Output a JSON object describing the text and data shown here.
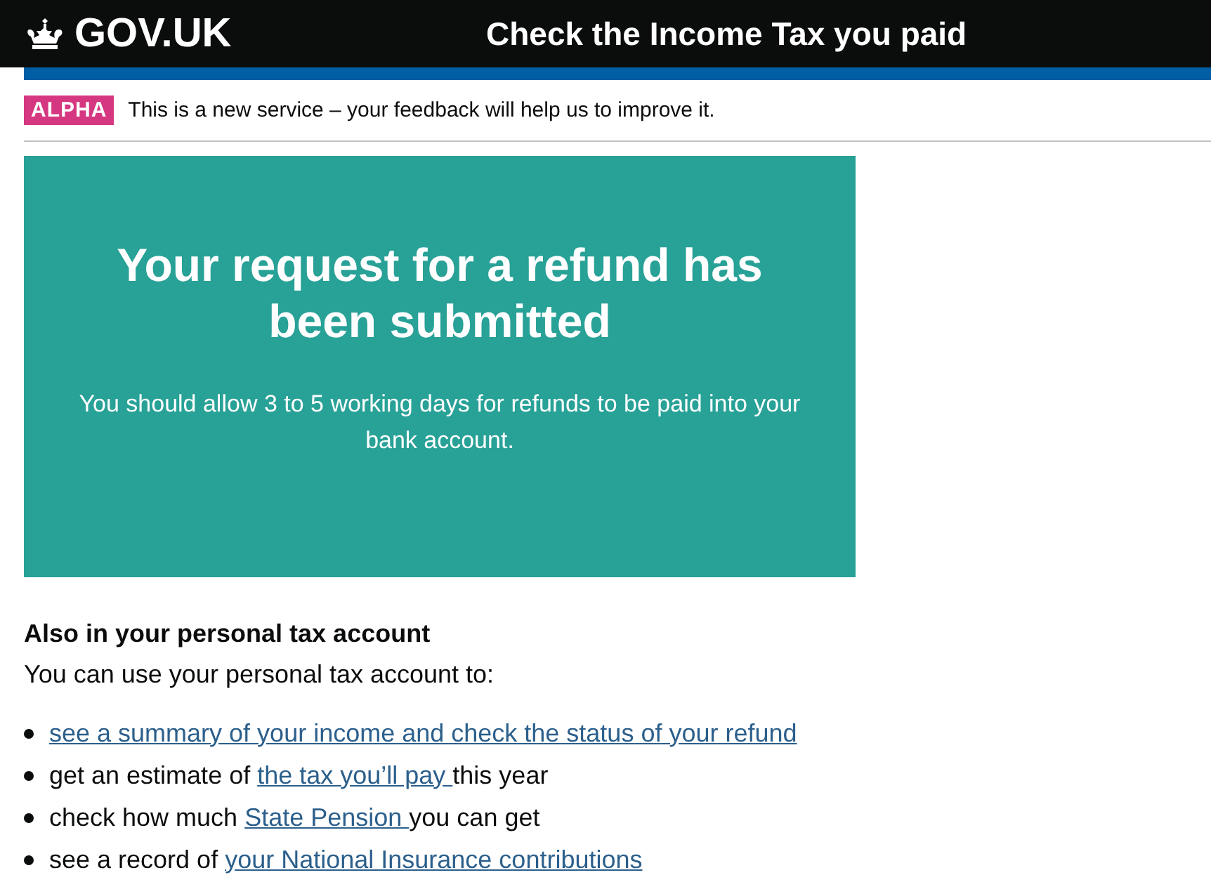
{
  "header": {
    "logo_text": "GOV.UK",
    "service_name": "Check the Income Tax you paid"
  },
  "phase_banner": {
    "tag": "ALPHA",
    "text": "This is a new service – your feedback will help us to improve it."
  },
  "confirmation_panel": {
    "title": "Your request for a refund has been submitted",
    "body": "You should allow 3 to 5 working days for refunds to be paid into your bank account."
  },
  "section": {
    "heading": "Also in your personal tax account",
    "intro": "You can use your personal tax account to:",
    "items": [
      {
        "link": "see a summary of your income and check the status of your refund"
      },
      {
        "before": "get an estimate of ",
        "link": "the tax you’ll pay ",
        "after": "this year"
      },
      {
        "before": "check how much ",
        "link": "State Pension ",
        "after": "you can get"
      },
      {
        "before": "see a record of ",
        "link": "your National Insurance contributions"
      }
    ]
  }
}
